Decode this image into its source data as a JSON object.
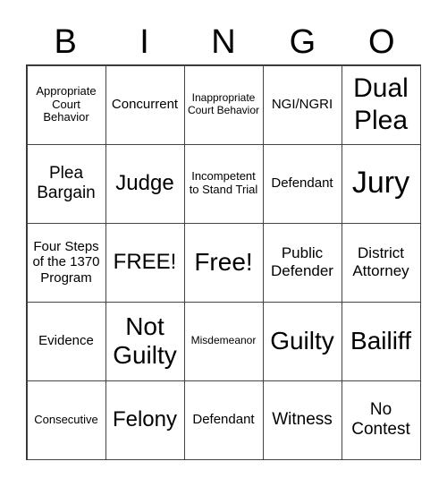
{
  "header": {
    "letters": [
      "B",
      "I",
      "N",
      "G",
      "O"
    ]
  },
  "board": {
    "rows": [
      [
        {
          "text": "Appropriate Court Behavior",
          "size": "s-sm"
        },
        {
          "text": "Concurrent",
          "size": "s-md"
        },
        {
          "text": "Inappropriate Court Behavior",
          "size": "s-xs"
        },
        {
          "text": "NGI/NGRI",
          "size": "s-md"
        },
        {
          "text": "Dual Plea",
          "size": "s-4xl"
        }
      ],
      [
        {
          "text": "Plea Bargain",
          "size": "s-xl"
        },
        {
          "text": "Judge",
          "size": "s-2xl"
        },
        {
          "text": "Incompetent to Stand Trial",
          "size": "s-sm"
        },
        {
          "text": "Defendant",
          "size": "s-md"
        },
        {
          "text": "Jury",
          "size": "s-5xl"
        }
      ],
      [
        {
          "text": "Four Steps of the 1370 Program",
          "size": "s-md"
        },
        {
          "text": "FREE!",
          "size": "s-2xl"
        },
        {
          "text": "Free!",
          "size": "s-3xl"
        },
        {
          "text": "Public Defender",
          "size": "s-lg"
        },
        {
          "text": "District Attorney",
          "size": "s-lg"
        }
      ],
      [
        {
          "text": "Evidence",
          "size": "s-md"
        },
        {
          "text": "Not Guilty",
          "size": "s-3xl"
        },
        {
          "text": "Misdemeanor",
          "size": "s-xs"
        },
        {
          "text": "Guilty",
          "size": "s-3xl"
        },
        {
          "text": "Bailiff",
          "size": "s-3xl"
        }
      ],
      [
        {
          "text": "Consecutive",
          "size": "s-sm"
        },
        {
          "text": "Felony",
          "size": "s-2xl"
        },
        {
          "text": "Defendant",
          "size": "s-md"
        },
        {
          "text": "Witness",
          "size": "s-xl"
        },
        {
          "text": "No Contest",
          "size": "s-xl"
        }
      ]
    ]
  }
}
